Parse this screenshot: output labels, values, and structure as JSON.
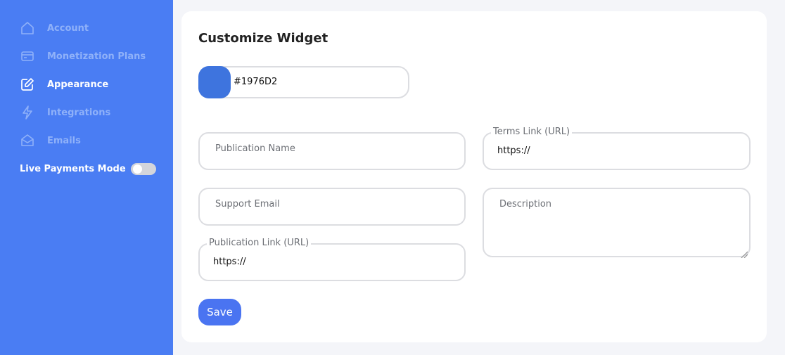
{
  "sidebar": {
    "items": [
      {
        "label": "Account",
        "icon": "home-icon"
      },
      {
        "label": "Monetization Plans",
        "icon": "credit-card-icon"
      },
      {
        "label": "Appearance",
        "icon": "edit-icon",
        "active": true
      },
      {
        "label": "Integrations",
        "icon": "lightning-icon"
      },
      {
        "label": "Emails",
        "icon": "envelope-icon"
      }
    ],
    "live_payments_label": "Live Payments Mode",
    "live_payments_enabled": false
  },
  "main": {
    "title": "Customize Widget",
    "color": {
      "value": "#1976D2",
      "swatch": "#3e74de"
    },
    "fields": {
      "publication_name": {
        "placeholder": "Publication Name"
      },
      "terms_link": {
        "label": "Terms Link (URL)",
        "value": "https://"
      },
      "support_email": {
        "placeholder": "Support Email"
      },
      "description": {
        "placeholder": "Description"
      },
      "publication_link": {
        "label": "Publication Link (URL)",
        "value": "https://"
      }
    },
    "save_label": "Save"
  },
  "colors": {
    "sidebar_bg": "#4a7df3",
    "accent": "#4a74f1",
    "page_bg": "#f4f5f9"
  }
}
